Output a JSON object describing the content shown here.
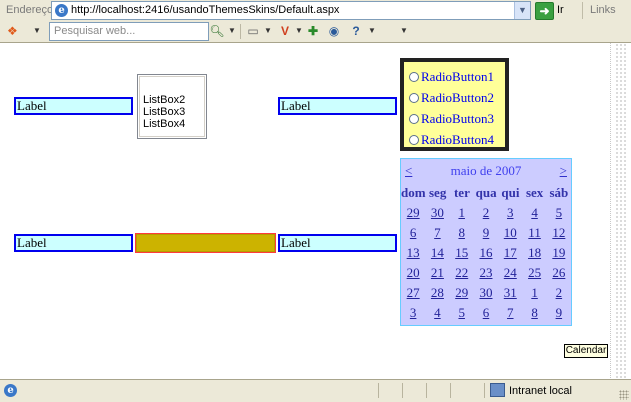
{
  "address_bar": {
    "label": "Endereço",
    "url": "http://localhost:2416/usandoThemesSkins/Default.aspx",
    "go_label": "Ir",
    "links_label": "Links"
  },
  "toolbar": {
    "search_placeholder": "Pesquisar web...",
    "icons": [
      "windows-icon",
      "search-go-icon",
      "page-icon",
      "wallet-icon",
      "bookmark-add-icon",
      "shield-icon",
      "help-icon"
    ]
  },
  "page": {
    "labels": [
      "Label",
      "Label",
      "Label",
      "Label"
    ],
    "listbox": {
      "items": [
        "",
        "ListBox2",
        "ListBox3",
        "ListBox4"
      ]
    },
    "radio_buttons": [
      "RadioButton1",
      "RadioButton2",
      "RadioButton3",
      "RadioButton4"
    ],
    "calendar": {
      "prev": "<",
      "next": ">",
      "month": "maio de 2007",
      "weekdays": [
        "dom",
        "seg",
        "ter",
        "qua",
        "qui",
        "sex",
        "sáb"
      ],
      "weeks": [
        [
          "29",
          "30",
          "1",
          "2",
          "3",
          "4",
          "5"
        ],
        [
          "6",
          "7",
          "8",
          "9",
          "10",
          "11",
          "12"
        ],
        [
          "13",
          "14",
          "15",
          "16",
          "17",
          "18",
          "19"
        ],
        [
          "20",
          "21",
          "22",
          "23",
          "24",
          "25",
          "26"
        ],
        [
          "27",
          "28",
          "29",
          "30",
          "31",
          "1",
          "2"
        ],
        [
          "3",
          "4",
          "5",
          "6",
          "7",
          "8",
          "9"
        ]
      ]
    },
    "tooltip": "Calendar"
  },
  "status_bar": {
    "zone": "Intranet local"
  },
  "colors": {
    "label_bg": "#ccffff",
    "label_border": "#0000ee",
    "radio_bg": "#ffff99",
    "calendar_bg": "#ccccff",
    "yellow_box": "#ccb300"
  }
}
